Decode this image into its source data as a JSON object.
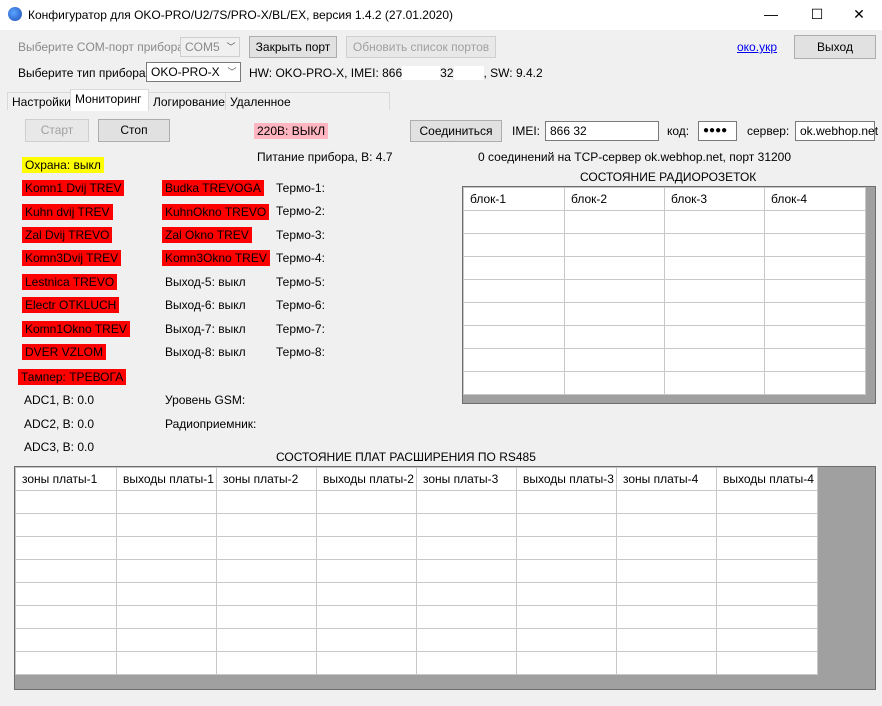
{
  "window": {
    "title": "Конфигуратор для OKO-PRO/U2/7S/PRO-X/BL/EX, версия 1.4.2 (27.01.2020)",
    "minimize": "—",
    "maximize": "☐",
    "close": "✕"
  },
  "top": {
    "com_label": "Выберите COM-порт прибора:",
    "com_value": "COM5",
    "close_port": "Закрыть порт",
    "refresh_ports": "Обновить список портов",
    "link": "око.укр",
    "exit": "Выход",
    "device_label": "Выберите тип прибора:",
    "device_value": "OKO-PRO-X",
    "hw_prefix": "HW: OKO-PRO-X, IMEI: 866",
    "hw_mid": "32",
    "hw_suffix": ", SW: 9.4.2"
  },
  "tabs": [
    "Настройки",
    "Мониторинг",
    "Логирование",
    "Удаленное конфигурирование"
  ],
  "monitor": {
    "start": "Старт",
    "stop": "Стоп",
    "power_status": "220В: ВЫКЛ",
    "power_supply": "Питание прибора, В: 4.7",
    "connect": "Соединиться",
    "imei_label": "IMEI:",
    "imei_value": "866           32",
    "code_label": "код:",
    "code_value": "●●●●",
    "server_label": "сервер:",
    "server_value": "ok.webhop.net",
    "tcp_info": "0 соединений на TCP-сервер ok.webhop.net, порт 31200",
    "guard": "Охрана: выкл",
    "zones_col1": [
      "Komn1 Dvij TREV",
      "Kuhn dvij TREV",
      "Zal Dvij TREVO",
      "Komn3Dvij TREV",
      "Lestnica TREVO",
      "Electr OTKLUCH",
      "Komn1Okno TREV",
      "DVER VZLOM"
    ],
    "zones_col2": [
      "Budka TREVOGA",
      "KuhnOkno TREVO",
      "Zal Okno TREV",
      "Komn3Okno TREV"
    ],
    "outputs": [
      "Выход-5: выкл",
      "Выход-6: выкл",
      "Выход-7: выкл",
      "Выход-8: выкл"
    ],
    "thermo": [
      "Термо-1:",
      "Термо-2:",
      "Термо-3:",
      "Термо-4:",
      "Термо-5:",
      "Термо-6:",
      "Термо-7:",
      "Термо-8:"
    ],
    "tamper": "Тампер: ТРЕВОГА",
    "adc": [
      "ADC1, В: 0.0",
      "ADC2, В: 0.0",
      "ADC3, В: 0.0"
    ],
    "gsm": "Уровень GSM:",
    "radio": "Радиоприемник:",
    "radio_title": "СОСТОЯНИЕ РАДИОРОЗЕТОК",
    "radio_headers": [
      "блок-1",
      "блок-2",
      "блок-3",
      "блок-4"
    ],
    "rs485_title": "СОСТОЯНИЕ ПЛАТ РАСШИРЕНИЯ ПО RS485",
    "rs485_headers": [
      "зоны платы-1",
      "выходы платы-1",
      "зоны платы-2",
      "выходы платы-2",
      "зоны платы-3",
      "выходы платы-3",
      "зоны платы-4",
      "выходы платы-4"
    ]
  }
}
